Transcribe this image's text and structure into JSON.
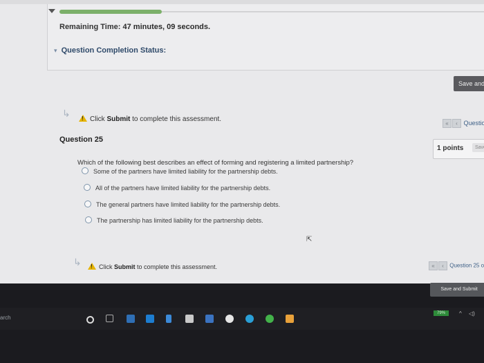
{
  "header": {
    "remaining_label": "Remaining Time:",
    "remaining_value": "47 minutes, 09 seconds.",
    "completion_status_label": "Question Completion Status:"
  },
  "toolbar": {
    "save_label": "Save and",
    "question_nav_top": "Questio",
    "question_nav_bottom": "Question 25 o",
    "save_submit_label": "Save and Submit"
  },
  "submit_notice": {
    "prefix": "Click ",
    "bold": "Submit",
    "suffix": " to complete this assessment."
  },
  "question": {
    "title": "Question 25",
    "points": "1 points",
    "points_save": "Save",
    "text": "Which of the following best describes an effect of forming and registering a limited partnership?",
    "options": [
      "Some of the partners have limited liability for the partnership debts.",
      "All of the partners have limited liability for the partnership debts.",
      "The general partners have limited liability for the partnership debts.",
      "The partnership has limited liability for the partnership debts."
    ]
  },
  "taskbar": {
    "search_text": "arch",
    "battery": "79%"
  },
  "colors": {
    "progress": "#7cb06a",
    "link": "#3d5f86",
    "warning": "#e6b400"
  }
}
